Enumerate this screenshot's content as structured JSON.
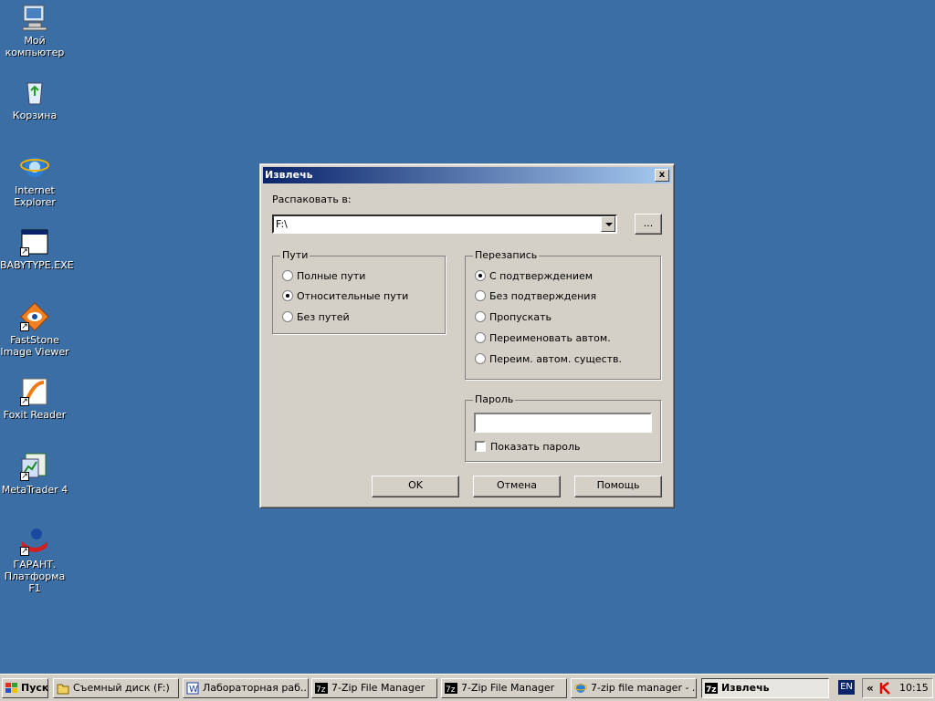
{
  "desktop": {
    "icons": [
      {
        "label": "Мой компьютер",
        "icon": "my-computer-icon"
      },
      {
        "label": "Корзина",
        "icon": "recycle-bin-icon"
      },
      {
        "label": "Internet Explorer",
        "icon": "internet-explorer-icon"
      },
      {
        "label": "BABYTYPE.EXE",
        "icon": "application-icon"
      },
      {
        "label": "FastStone Image Viewer",
        "icon": "faststone-icon"
      },
      {
        "label": "Foxit Reader",
        "icon": "foxit-reader-icon"
      },
      {
        "label": "MetaTrader 4",
        "icon": "metatrader-icon"
      },
      {
        "label": "ГАРАНТ. Платформа F1",
        "icon": "garant-icon"
      }
    ]
  },
  "dialog": {
    "title": "Извлечь",
    "close_label": "x",
    "extract_to_label": "Распаковать в:",
    "extract_to_value": "F:\\",
    "browse_label": "...",
    "paths_group": {
      "title": "Пути",
      "options": [
        "Полные пути",
        "Относительные пути",
        "Без путей"
      ],
      "selected": 1
    },
    "overwrite_group": {
      "title": "Перезапись",
      "options": [
        "С подтверждением",
        "Без подтверждения",
        "Пропускать",
        "Переименовать автом.",
        "Переим. автом. существ."
      ],
      "selected": 0
    },
    "password_group": {
      "title": "Пароль",
      "value": "",
      "show_password_label": "Показать пароль"
    },
    "buttons": {
      "ok": "OK",
      "cancel": "Отмена",
      "help": "Помощь"
    }
  },
  "taskbar": {
    "start_label": "Пуск",
    "tasks": [
      {
        "label": "Съемный диск (F:)",
        "icon": "folder-icon",
        "active": false
      },
      {
        "label": "Лабораторная раб...",
        "icon": "word-icon",
        "active": false
      },
      {
        "label": "7-Zip File Manager",
        "icon": "7zip-icon",
        "active": false
      },
      {
        "label": "7-Zip File Manager",
        "icon": "7zip-icon",
        "active": false
      },
      {
        "label": "7-zip file manager - ...",
        "icon": "ie-icon",
        "active": false
      },
      {
        "label": "Извлечь",
        "icon": "7zip-icon",
        "active": true
      }
    ],
    "language": "EN",
    "tray_chevron": "«",
    "clock": "10:15"
  }
}
